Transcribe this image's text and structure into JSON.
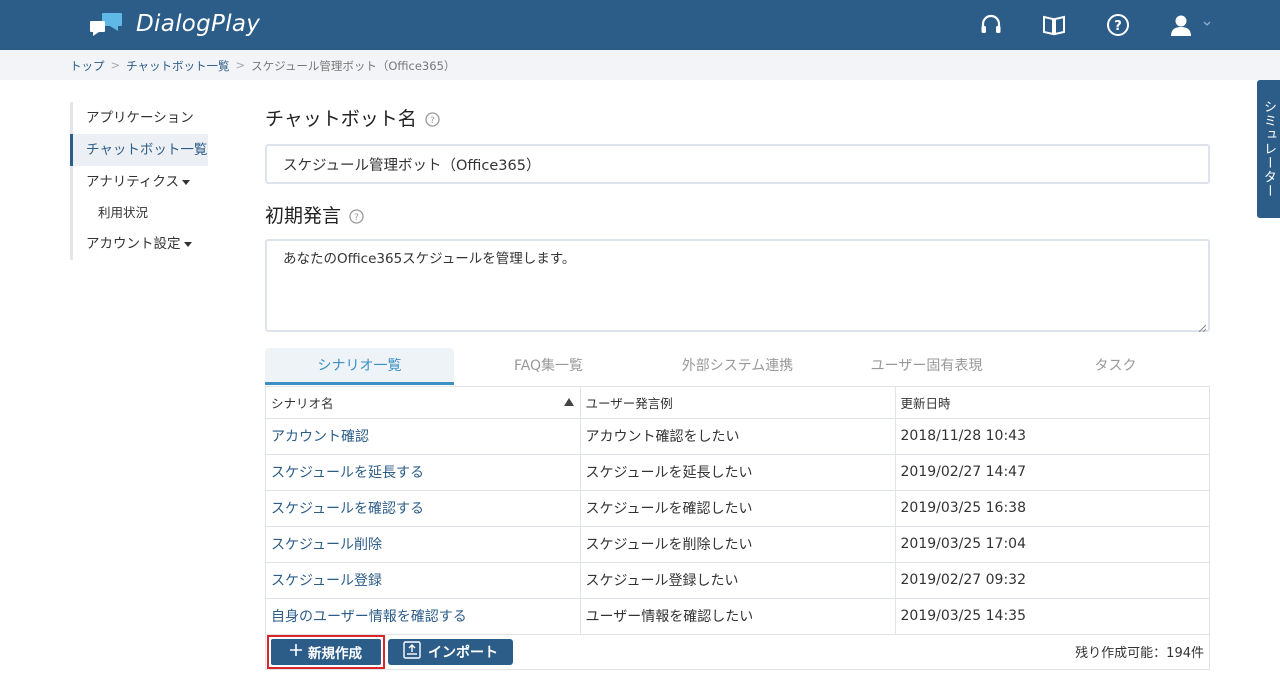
{
  "app": {
    "title": "DialogPlay"
  },
  "breadcrumb": {
    "items": [
      "トップ",
      "チャットボット一覧"
    ],
    "current": "スケジュール管理ボット（Office365）",
    "separator": ">"
  },
  "sidebar": {
    "items": [
      {
        "label": "アプリケーション"
      },
      {
        "label": "チャットボット一覧"
      },
      {
        "label": "アナリティクス"
      },
      {
        "label": "利用状況"
      },
      {
        "label": "アカウント設定"
      }
    ]
  },
  "main": {
    "chatbot_name_title": "チャットボット名",
    "chatbot_name_value": "スケジュール管理ボット（Office365）",
    "initial_message_title": "初期発言",
    "initial_message_value": "あなたのOffice365スケジュールを管理します。"
  },
  "tabs": [
    {
      "label": "シナリオ一覧"
    },
    {
      "label": "FAQ集一覧"
    },
    {
      "label": "外部システム連携"
    },
    {
      "label": "ユーザー固有表現"
    },
    {
      "label": "タスク"
    }
  ],
  "table": {
    "headers": [
      "シナリオ名",
      "ユーザー発言例",
      "更新日時"
    ],
    "rows": [
      [
        "アカウント確認",
        "アカウント確認をしたい",
        "2018/11/28 10:43"
      ],
      [
        "スケジュールを延長する",
        "スケジュールを延長したい",
        "2019/02/27 14:47"
      ],
      [
        "スケジュールを確認する",
        "スケジュールを確認したい",
        "2019/03/25 16:38"
      ],
      [
        "スケジュール削除",
        "スケジュールを削除したい",
        "2019/03/25 17:04"
      ],
      [
        "スケジュール登録",
        "スケジュール登録したい",
        "2019/02/27 09:32"
      ],
      [
        "自身のユーザー情報を確認する",
        "ユーザー情報を確認したい",
        "2019/03/25 14:35"
      ]
    ]
  },
  "actions": {
    "new_label": "新規作成",
    "import_label": "インポート",
    "remaining": "残り作成可能：194件"
  },
  "simulator": {
    "label": "シミュレーター"
  },
  "colors": {
    "header": "#2c5d89",
    "accent": "#3a8fc4",
    "highlight": "#d9262b"
  }
}
